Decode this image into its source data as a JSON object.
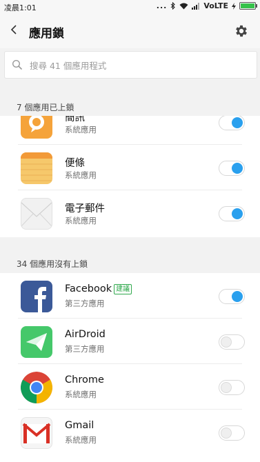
{
  "status": {
    "time": "凌晨1:01",
    "dots": "...",
    "bluetooth_icon": "bluetooth-icon",
    "wifi_icon": "wifi-icon",
    "signal_icon": "signal-icon",
    "network": "VoLTE",
    "charging_icon": "charging-icon",
    "battery_icon": "battery-icon"
  },
  "header": {
    "title": "應用鎖",
    "back_icon": "back-arrow-icon",
    "settings_icon": "gear-icon"
  },
  "search": {
    "placeholder": "搜尋 41 個應用程式",
    "icon": "search-icon"
  },
  "locked_section": {
    "label": "7 個應用已上鎖",
    "items": [
      {
        "name": "簡訊",
        "sub": "系統應用",
        "icon": "messaging-app-icon",
        "locked": true
      },
      {
        "name": "便條",
        "sub": "系統應用",
        "icon": "notes-app-icon",
        "locked": true
      },
      {
        "name": "電子郵件",
        "sub": "系統應用",
        "icon": "email-app-icon",
        "locked": true
      }
    ]
  },
  "unlocked_section": {
    "label": "34 個應用沒有上鎖",
    "items": [
      {
        "name": "Facebook",
        "badge": "建議",
        "sub": "第三方應用",
        "icon": "facebook-app-icon",
        "locked": true
      },
      {
        "name": "AirDroid",
        "sub": "第三方應用",
        "icon": "airdroid-app-icon",
        "locked": false
      },
      {
        "name": "Chrome",
        "sub": "系統應用",
        "icon": "chrome-app-icon",
        "locked": false
      },
      {
        "name": "Gmail",
        "sub": "系統應用",
        "icon": "gmail-app-icon",
        "locked": false
      }
    ]
  },
  "colors": {
    "toggle_on": "#2aa0ee",
    "badge": "#2ea84b",
    "background": "#f2f2f2"
  }
}
